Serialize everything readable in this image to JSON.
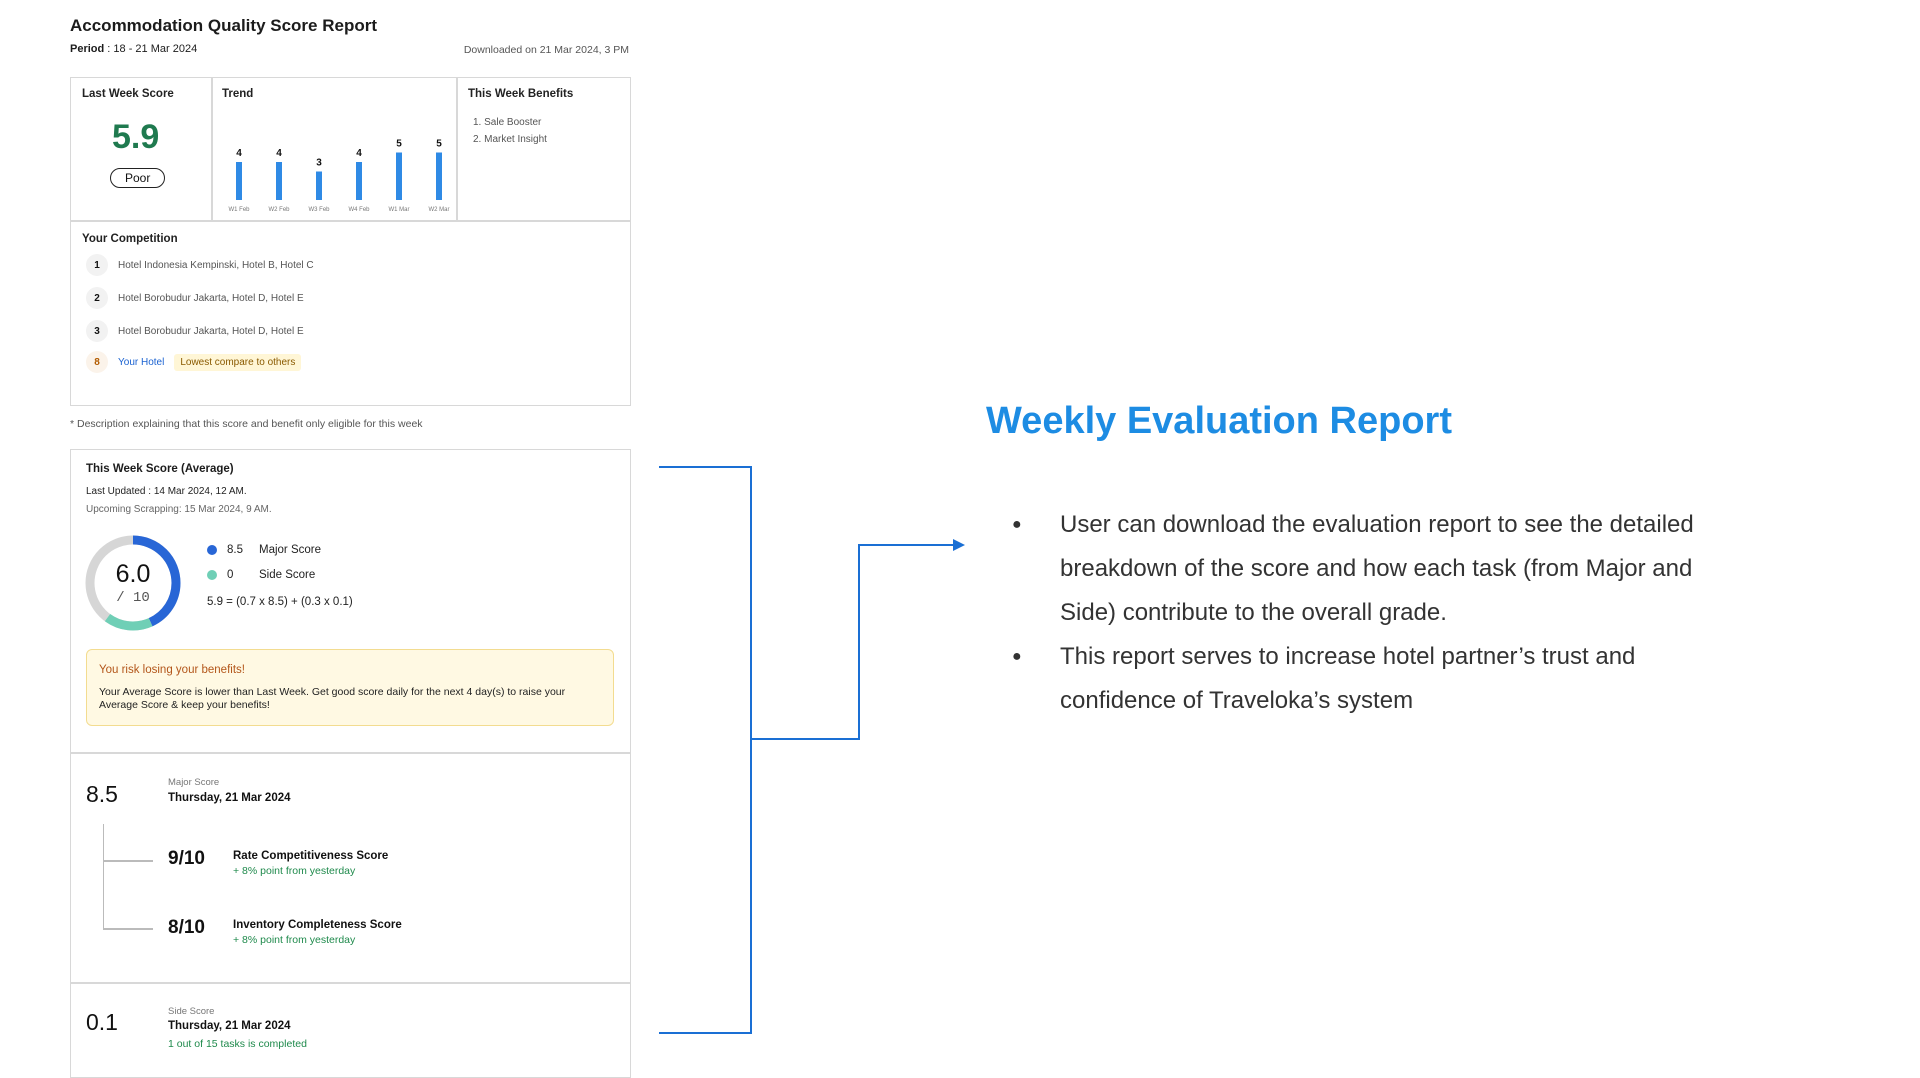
{
  "report": {
    "title": "Accommodation Quality Score Report",
    "period_label": "Period",
    "period_value": ": 18 - 21 Mar 2024",
    "downloaded": "Downloaded on 21 Mar 2024, 3 PM"
  },
  "last_week": {
    "label": "Last Week Score",
    "score": "5.9",
    "grade": "Poor"
  },
  "trend": {
    "label": "Trend",
    "chart_data": {
      "type": "bar",
      "categories": [
        "W1 Feb",
        "W2 Feb",
        "W3 Feb",
        "W4 Feb",
        "W1 Mar",
        "W2 Mar"
      ],
      "values": [
        4,
        4,
        3,
        4,
        5,
        5
      ],
      "ylim": [
        0,
        10
      ]
    }
  },
  "benefits": {
    "label": "This Week Benefits",
    "items": [
      "1. Sale Booster",
      "2. Market Insight"
    ]
  },
  "competition": {
    "label": "Your Competition",
    "rows": [
      {
        "rank": "1",
        "name": "Hotel Indonesia Kempinski, Hotel B, Hotel C"
      },
      {
        "rank": "2",
        "name": "Hotel Borobudur Jakarta, Hotel D, Hotel E"
      },
      {
        "rank": "3",
        "name": "Hotel Borobudur Jakarta, Hotel D, Hotel E"
      }
    ],
    "mine": {
      "rank": "8",
      "name": "Your Hotel",
      "badge": "Lowest compare to others"
    }
  },
  "note": "* Description explaining that this score and benefit only eligible for this week",
  "this_week": {
    "label": "This Week Score (Average)",
    "last_updated": "Last Updated : 14 Mar 2024, 12 AM.",
    "upcoming": "Upcoming Scrapping: 15 Mar 2024, 9 AM.",
    "score": "6.0",
    "out_of": "/ 10",
    "donut_fraction": 0.6,
    "major_value": "8.5",
    "major_label": "Major Score",
    "side_value": "0",
    "side_label": "Side Score",
    "formula": "5.9 = (0.7 x 8.5) + (0.3 x 0.1)",
    "colors": {
      "major": "#2866d6",
      "side": "#6fcfb6",
      "track": "#d6d6d6"
    }
  },
  "warning": {
    "title": "You risk losing your benefits!",
    "body": "Your Average Score is lower than Last Week. Get good score daily for the next 4 day(s) to raise your Average Score & keep your benefits!"
  },
  "major": {
    "score": "8.5",
    "type": "Major Score",
    "date": "Thursday, 21 Mar 2024",
    "items": [
      {
        "score": "9/10",
        "label": "Rate Competitiveness Score",
        "delta": "+ 8% point from yesterday"
      },
      {
        "score": "8/10",
        "label": "Inventory Completeness Score",
        "delta": "+ 8% point from yesterday"
      }
    ]
  },
  "side": {
    "score": "0.1",
    "type": "Side Score",
    "date": "Thursday, 21 Mar 2024",
    "progress": "1 out of 15 tasks is completed"
  },
  "explain": {
    "title": "Weekly Evaluation Report",
    "bullets": [
      "User can download the evaluation report to see the detailed breakdown of the score and how each task (from Major and Side) contribute to the overall grade.",
      "This report serves to increase hotel partner’s trust and confidence of Traveloka’s system"
    ]
  },
  "accent_color": "#1d8ce3",
  "connector_color": "#1a6fd4"
}
